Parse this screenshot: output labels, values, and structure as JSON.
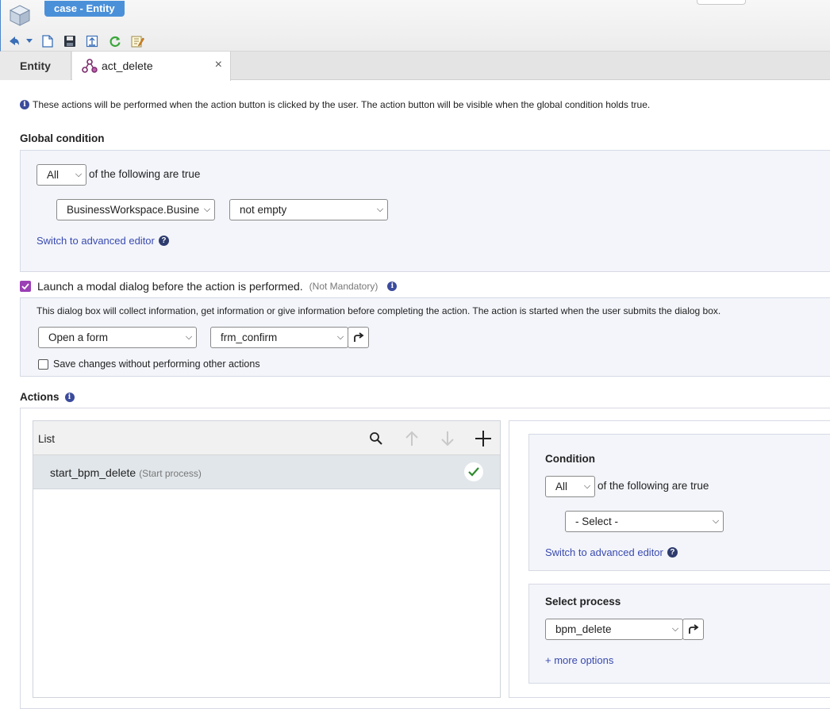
{
  "window": {
    "title": "case - Entity"
  },
  "tabs": {
    "entity_label": "Entity",
    "active_label": "act_delete",
    "close_glyph": "×"
  },
  "intro": {
    "text": "These actions will be performed when the action button is clicked by the user. The action button will be visible when the global condition holds true."
  },
  "global_condition": {
    "title": "Global condition",
    "quantifier": "All",
    "quantifier_suffix": "of the following are true",
    "field": "BusinessWorkspace.Busine",
    "operator": "not empty",
    "advanced_link": "Switch to advanced editor"
  },
  "modal": {
    "checkbox_label": "Launch a modal dialog before the action is performed.",
    "not_mandatory": "(Not Mandatory)",
    "description": "This dialog box will collect information, get information or give information before completing the action. The action is started when the user submits the dialog box.",
    "mode": "Open a form",
    "form": "frm_confirm",
    "save_only_label": "Save changes without performing other actions"
  },
  "actions": {
    "title": "Actions",
    "list_header": "List",
    "items": [
      {
        "name": "start_bpm_delete",
        "type": "(Start process)"
      }
    ]
  },
  "condition": {
    "title": "Condition",
    "quantifier": "All",
    "quantifier_suffix": "of the following are true",
    "field": "- Select -",
    "advanced_link": "Switch to advanced editor"
  },
  "process": {
    "title": "Select process",
    "value": "bpm_delete",
    "more_options": "+ more options"
  },
  "icons": {
    "help": "?",
    "info": "i"
  },
  "colors": {
    "accent": "#4a90d9",
    "link": "#3a4ab0",
    "checkbox": "#9b3fb5",
    "success": "#2e8b2e"
  }
}
